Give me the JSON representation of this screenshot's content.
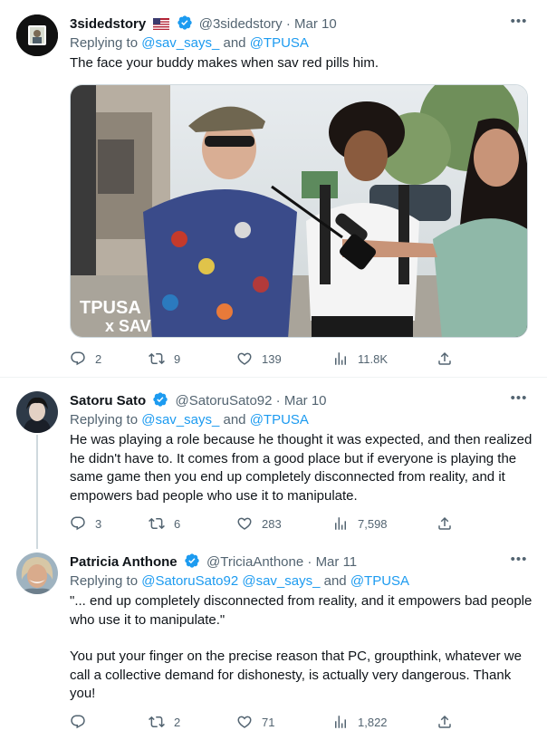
{
  "tweets": [
    {
      "name": "3sidedstory",
      "handle": "@3sidedstory",
      "date": "Mar 10",
      "reply_prefix": "Replying to ",
      "reply_mention_1": "@sav_says_",
      "reply_and": " and ",
      "reply_mention_2": "@TPUSA",
      "text": "The face your buddy makes when sav red pills him.",
      "media_watermark_1": "TPUSA",
      "media_watermark_2": "x SAV",
      "stats": {
        "replies": "2",
        "retweets": "9",
        "likes": "139",
        "views": "11.8K"
      }
    },
    {
      "name": "Satoru Sato",
      "handle": "@SatoruSato92",
      "date": "Mar 10",
      "reply_prefix": "Replying to ",
      "reply_mention_1": "@sav_says_",
      "reply_and": " and ",
      "reply_mention_2": "@TPUSA",
      "text": "He was playing a role because he thought it was expected, and then realized he didn't have to. It comes from a good place but if everyone is playing the same game then you end up completely disconnected from reality, and it empowers bad people who use it to manipulate.",
      "stats": {
        "replies": "3",
        "retweets": "6",
        "likes": "283",
        "views": "7,598"
      }
    },
    {
      "name": "Patricia Anthone",
      "handle": "@TriciaAnthone",
      "date": "Mar 11",
      "reply_prefix": "Replying to ",
      "reply_mention_1": "@SatoruSato92",
      "reply_mention_mid": " @sav_says_",
      "reply_and": " and ",
      "reply_mention_2": "@TPUSA",
      "text_p1": "\"... end up completely disconnected from reality, and it empowers bad people who use it to manipulate.\"",
      "text_p2": "You put your finger on the precise reason that PC, groupthink, whatever we call a collective demand for dishonesty, is actually very dangerous. Thank you!",
      "stats": {
        "replies": "",
        "retweets": "2",
        "likes": "71",
        "views": "1,822"
      }
    }
  ],
  "separator": " · ",
  "colors": {
    "link": "#1d9bf0",
    "muted": "#536471",
    "verified": "#1d9bf0"
  }
}
